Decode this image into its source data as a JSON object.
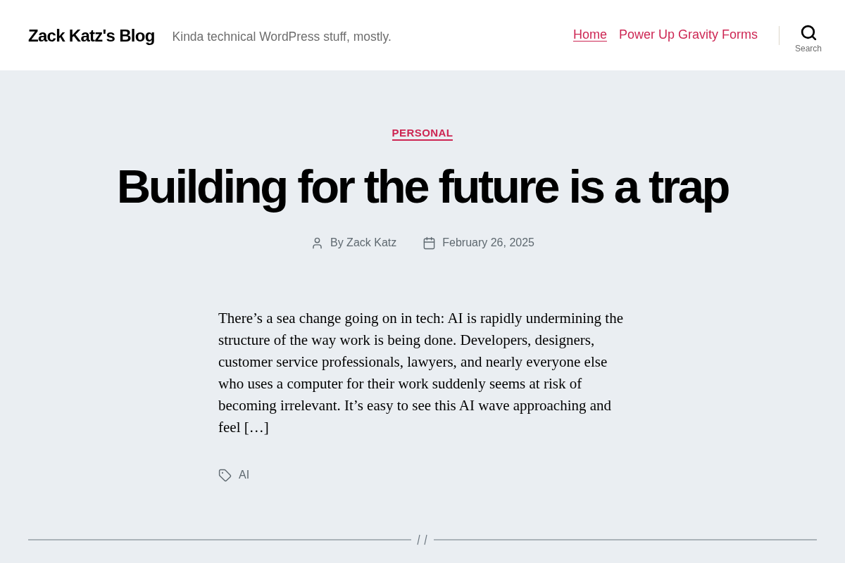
{
  "header": {
    "site_title": "Zack Katz's Blog",
    "site_description": "Kinda technical WordPress stuff, mostly.",
    "nav": [
      {
        "label": "Home",
        "selected": true
      },
      {
        "label": "Power Up Gravity Forms",
        "selected": false
      }
    ],
    "search_toggle": {
      "label": "Search"
    }
  },
  "post": {
    "category": "PERSONAL",
    "title": "Building for the future is a trap",
    "meta": {
      "author": "By Zack Katz",
      "date": "February 26, 2025"
    },
    "excerpt": "There’s a sea change going on in tech: AI is rapidly undermining the structure of the way work is being done. Developers, designers, customer service professionals, lawyers, and nearly everyone else who uses a computer for their work suddenly seems at risk of becoming irrelevant. It’s easy to see this AI wave approaching and feel […]",
    "tags": [
      "AI"
    ]
  }
}
